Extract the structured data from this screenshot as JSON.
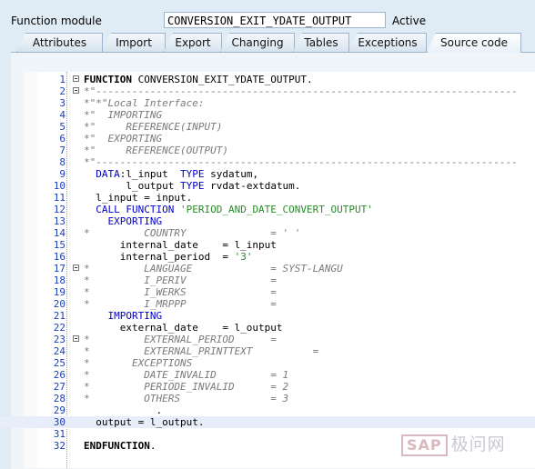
{
  "header": {
    "label": "Function module",
    "name": "CONVERSION_EXIT_YDATE_OUTPUT",
    "status": "Active"
  },
  "tabs": [
    {
      "label": "Attributes"
    },
    {
      "label": "Import"
    },
    {
      "label": "Export"
    },
    {
      "label": "Changing"
    },
    {
      "label": "Tables"
    },
    {
      "label": "Exceptions"
    },
    {
      "label": "Source code",
      "active": true
    }
  ],
  "code": {
    "lines": [
      {
        "no": "1",
        "fold": true,
        "segments": [
          {
            "t": "fn",
            "v": "FUNCTION "
          },
          {
            "t": "tx",
            "v": "CONVERSION_EXIT_YDATE_OUTPUT."
          }
        ]
      },
      {
        "no": "2",
        "fold": true,
        "segments": [
          {
            "t": "cm",
            "v": "*\"----------------------------------------------------------------------"
          }
        ]
      },
      {
        "no": "3",
        "segments": [
          {
            "t": "cm",
            "v": "*\"*\"Local Interface:"
          }
        ]
      },
      {
        "no": "4",
        "segments": [
          {
            "t": "cm",
            "v": "*\"  IMPORTING"
          }
        ]
      },
      {
        "no": "5",
        "segments": [
          {
            "t": "cm",
            "v": "*\"     REFERENCE(INPUT)"
          }
        ]
      },
      {
        "no": "6",
        "segments": [
          {
            "t": "cm",
            "v": "*\"  EXPORTING"
          }
        ]
      },
      {
        "no": "7",
        "segments": [
          {
            "t": "cm",
            "v": "*\"     REFERENCE(OUTPUT)"
          }
        ]
      },
      {
        "no": "8",
        "segments": [
          {
            "t": "cm",
            "v": "*\"----------------------------------------------------------------------"
          }
        ]
      },
      {
        "no": "9",
        "segments": [
          {
            "t": "kw",
            "v": "  DATA"
          },
          {
            "t": "tx",
            "v": ":l_input  "
          },
          {
            "t": "kw",
            "v": "TYPE"
          },
          {
            "t": "tx",
            "v": " sydatum,"
          }
        ]
      },
      {
        "no": "10",
        "segments": [
          {
            "t": "tx",
            "v": "       l_output "
          },
          {
            "t": "kw",
            "v": "TYPE"
          },
          {
            "t": "tx",
            "v": " rvdat-extdatum."
          }
        ]
      },
      {
        "no": "11",
        "segments": [
          {
            "t": "tx",
            "v": "  l_input = input."
          }
        ]
      },
      {
        "no": "12",
        "segments": [
          {
            "t": "kw",
            "v": "  CALL FUNCTION "
          },
          {
            "t": "st",
            "v": "'PERIOD_AND_DATE_CONVERT_OUTPUT'"
          }
        ]
      },
      {
        "no": "13",
        "segments": [
          {
            "t": "kw",
            "v": "    EXPORTING"
          }
        ]
      },
      {
        "no": "14",
        "segments": [
          {
            "t": "cm",
            "v": "*         COUNTRY              = ' '"
          }
        ]
      },
      {
        "no": "15",
        "segments": [
          {
            "t": "tx",
            "v": "      internal_date    = l_input"
          }
        ]
      },
      {
        "no": "16",
        "segments": [
          {
            "t": "tx",
            "v": "      internal_period  = "
          },
          {
            "t": "st",
            "v": "'3'"
          }
        ]
      },
      {
        "no": "17",
        "fold": true,
        "segments": [
          {
            "t": "cm",
            "v": "*         LANGUAGE             = SYST-LANGU"
          }
        ]
      },
      {
        "no": "18",
        "segments": [
          {
            "t": "cm",
            "v": "*         I_PERIV              ="
          }
        ]
      },
      {
        "no": "19",
        "segments": [
          {
            "t": "cm",
            "v": "*         I_WERKS              ="
          }
        ]
      },
      {
        "no": "20",
        "segments": [
          {
            "t": "cm",
            "v": "*         I_MRPPP              ="
          }
        ]
      },
      {
        "no": "21",
        "segments": [
          {
            "t": "kw",
            "v": "    IMPORTING"
          }
        ]
      },
      {
        "no": "22",
        "segments": [
          {
            "t": "tx",
            "v": "      external_date    = l_output"
          }
        ]
      },
      {
        "no": "23",
        "fold": true,
        "segments": [
          {
            "t": "cm",
            "v": "*         EXTERNAL_PERIOD      ="
          }
        ]
      },
      {
        "no": "24",
        "segments": [
          {
            "t": "cm",
            "v": "*         EXTERNAL_PRINTTEXT          ="
          }
        ]
      },
      {
        "no": "25",
        "segments": [
          {
            "t": "cm",
            "v": "*       EXCEPTIONS"
          }
        ]
      },
      {
        "no": "26",
        "segments": [
          {
            "t": "cm",
            "v": "*         DATE_INVALID         = 1"
          }
        ]
      },
      {
        "no": "27",
        "segments": [
          {
            "t": "cm",
            "v": "*         PERIODE_INVALID      = 2"
          }
        ]
      },
      {
        "no": "28",
        "segments": [
          {
            "t": "cm",
            "v": "*         OTHERS               = 3"
          }
        ]
      },
      {
        "no": "29",
        "segments": [
          {
            "t": "tx",
            "v": "            ."
          }
        ]
      },
      {
        "no": "30",
        "current": true,
        "segments": [
          {
            "t": "tx",
            "v": "  output = l_output."
          }
        ]
      },
      {
        "no": "31",
        "segments": []
      },
      {
        "no": "32",
        "segments": [
          {
            "t": "fn",
            "v": "ENDFUNCTION"
          },
          {
            "t": "tx",
            "v": "."
          }
        ]
      }
    ]
  },
  "watermark": {
    "box_text": "SAP",
    "text": "极问网"
  }
}
